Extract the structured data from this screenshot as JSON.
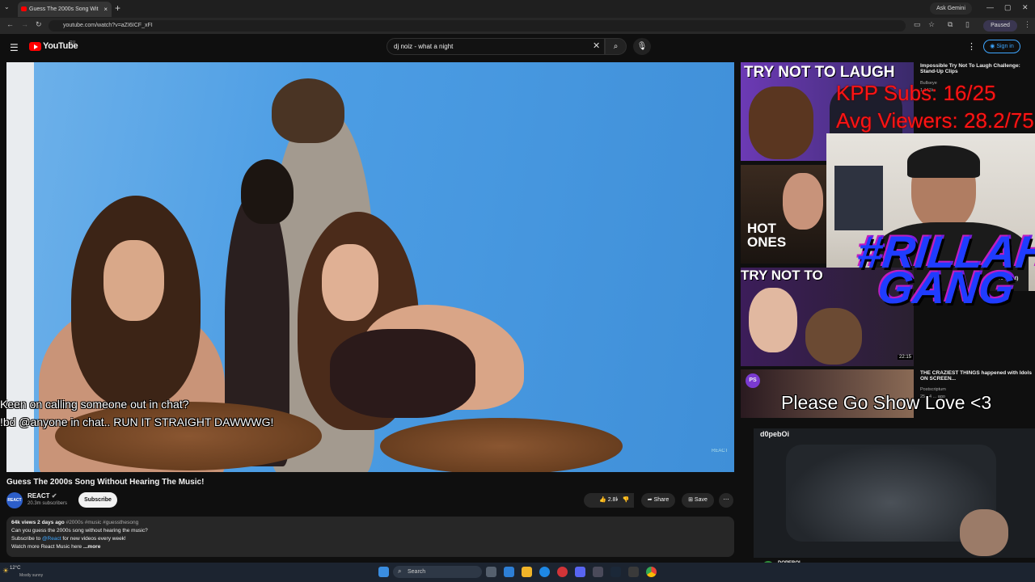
{
  "browser": {
    "tab_title": "Guess The 2000s Song Wit",
    "tab_close": "×",
    "new_tab": "+",
    "url": "youtube.com/watch?v=aZI6ICF_xFI",
    "ask_gemini": "Ask Gemini",
    "paused": "Paused",
    "minimize": "—",
    "maximize": "▢",
    "close": "✕"
  },
  "youtube": {
    "logo_text": "YouTube",
    "logo_country": "RU",
    "search_value": "dj noiz - what a night",
    "sign_in": "Sign in"
  },
  "video": {
    "chat_line_1": "Keen on calling someone out in chat?",
    "chat_line_2": "!bd @anyone in chat.. RUN IT STRAIGHT DAWWWG!",
    "watermark": "REACT",
    "title": "Guess The 2000s Song Without Hearing The Music!",
    "channel": "REACT",
    "channel_avatar": "REACT",
    "subscribers": "20.3m subscribers",
    "subscribe": "Subscribe",
    "likes": "2.8k",
    "share": "Share",
    "save": "Save",
    "description": {
      "stats": "64k views  2 days ago",
      "tags": "#2000s #music #guessthesong",
      "line1": "Can you guess the 2000s song without hearing the music?",
      "line2_prefix": "Subscribe to ",
      "line2_link": "@React",
      "line2_suffix": " for new videos every week!",
      "line3": "Watch more React Music here",
      "more": "...more"
    }
  },
  "sidebar": {
    "items": [
      {
        "thumb_text": "TRY NOT TO LAUGH",
        "title": "Impossible Try Not To Laugh Challenge: Stand-Up Clips",
        "channel": "Bullseye",
        "meta": "1.141k"
      },
      {
        "thumb_text": "HOT ONES"
      },
      {
        "thumb_text": "TRY NOT TO",
        "duration": "22:15",
        "title_fragment": "ot, 50 Cent)"
      },
      {
        "thumb_text": "PS",
        "title": "THE CRAZIEST THINGS happened with Idols ON SCREEN...",
        "channel": "Postscriptum",
        "meta": "25 · 4 ... ago"
      }
    ]
  },
  "overlays": {
    "kpp_subs": "KPP Subs: 16/25",
    "avg_viewers": "Avg Viewers: 28.2/75",
    "rillah_1": "#RILLAH",
    "rillah_2": "GANG",
    "please": "Please Go Show Love <3",
    "stream_name": "d0pebOi",
    "stream_footer_name": "DOPEBOI",
    "stream_footer_sub": "DBD Sweats | Stay Positive | KickPartner | PROMO3"
  },
  "taskbar": {
    "weather_temp": "12°C",
    "weather_desc": "Mostly sunny",
    "search": "Search"
  },
  "colors": {
    "accent_blue": "#3ea6ff",
    "yt_red": "#ff0000",
    "overlay_red": "#ff1414",
    "rillah_blue": "#1f3cff"
  }
}
